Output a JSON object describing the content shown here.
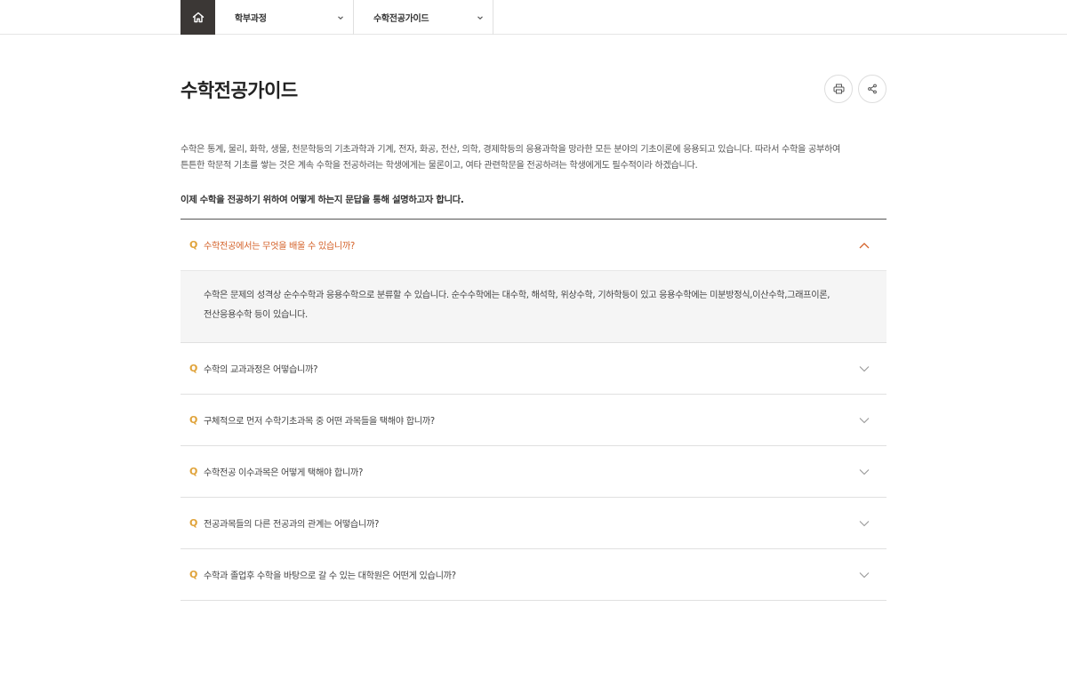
{
  "nav": {
    "home_icon": "home-icon",
    "crumbs": [
      {
        "label": "학부과정",
        "icon": "chevron-down-icon"
      },
      {
        "label": "수학전공가이드",
        "icon": "chevron-down-icon"
      }
    ]
  },
  "header": {
    "title": "수학전공가이드",
    "print_icon": "printer-icon",
    "share_icon": "share-icon"
  },
  "intro": {
    "line1": "수학은 통계, 물리, 화학, 생물, 천문학등의 기초과학과 기계, 전자, 화공, 전산, 의학, 경제학등의 응용과학을 망라한 모든 분야의 기초이론에 응용되고 있습니다. 따라서 수학을 공부하여",
    "line2": "튼튼한 학문적 기초를 쌓는 것은 계속 수학을 전공하려는 학생에게는 물론이고, 여타 관련학문을 전공하려는 학생에게도 필수적이라 하겠습니다.",
    "lead": "이제 수학을 전공하기 위하여 어떻게 하는지 문답을 통해 설명하고자 합니다."
  },
  "colors": {
    "accent_q": "#e0a33a",
    "active_question": "#d4622a",
    "home_bg": "#3b3735"
  },
  "faq": [
    {
      "q_mark": "Q",
      "question": "수학전공에서는 무엇을 배울 수 있습니까?",
      "state": "expanded",
      "answer_line1": "수학은 문제의 성격상 순수수학과 응용수학으로 분류할 수 있습니다. 순수수학에는 대수학, 해석학, 위상수학, 기하학등이 있고 응용수학에는 미분방정식,이산수학,그래프이론,",
      "answer_line2": "전산응용수학 등이 있습니다."
    },
    {
      "q_mark": "Q",
      "question": "수학의 교과과정은 어떻습니까?",
      "state": "collapsed"
    },
    {
      "q_mark": "Q",
      "question": "구체적으로 먼저 수학기초과목 중 어떤 과목들을 택해야 합니까?",
      "state": "collapsed"
    },
    {
      "q_mark": "Q",
      "question": "수학전공 이수과목은 어떻게 택해야 합니까?",
      "state": "collapsed"
    },
    {
      "q_mark": "Q",
      "question": "전공과목들의 다른 전공과의 관계는 어떻습니까?",
      "state": "collapsed"
    },
    {
      "q_mark": "Q",
      "question": "수학과 졸업후 수학을 바탕으로 갈 수 있는 대학원은 어떤게 있습니까?",
      "state": "collapsed"
    }
  ]
}
